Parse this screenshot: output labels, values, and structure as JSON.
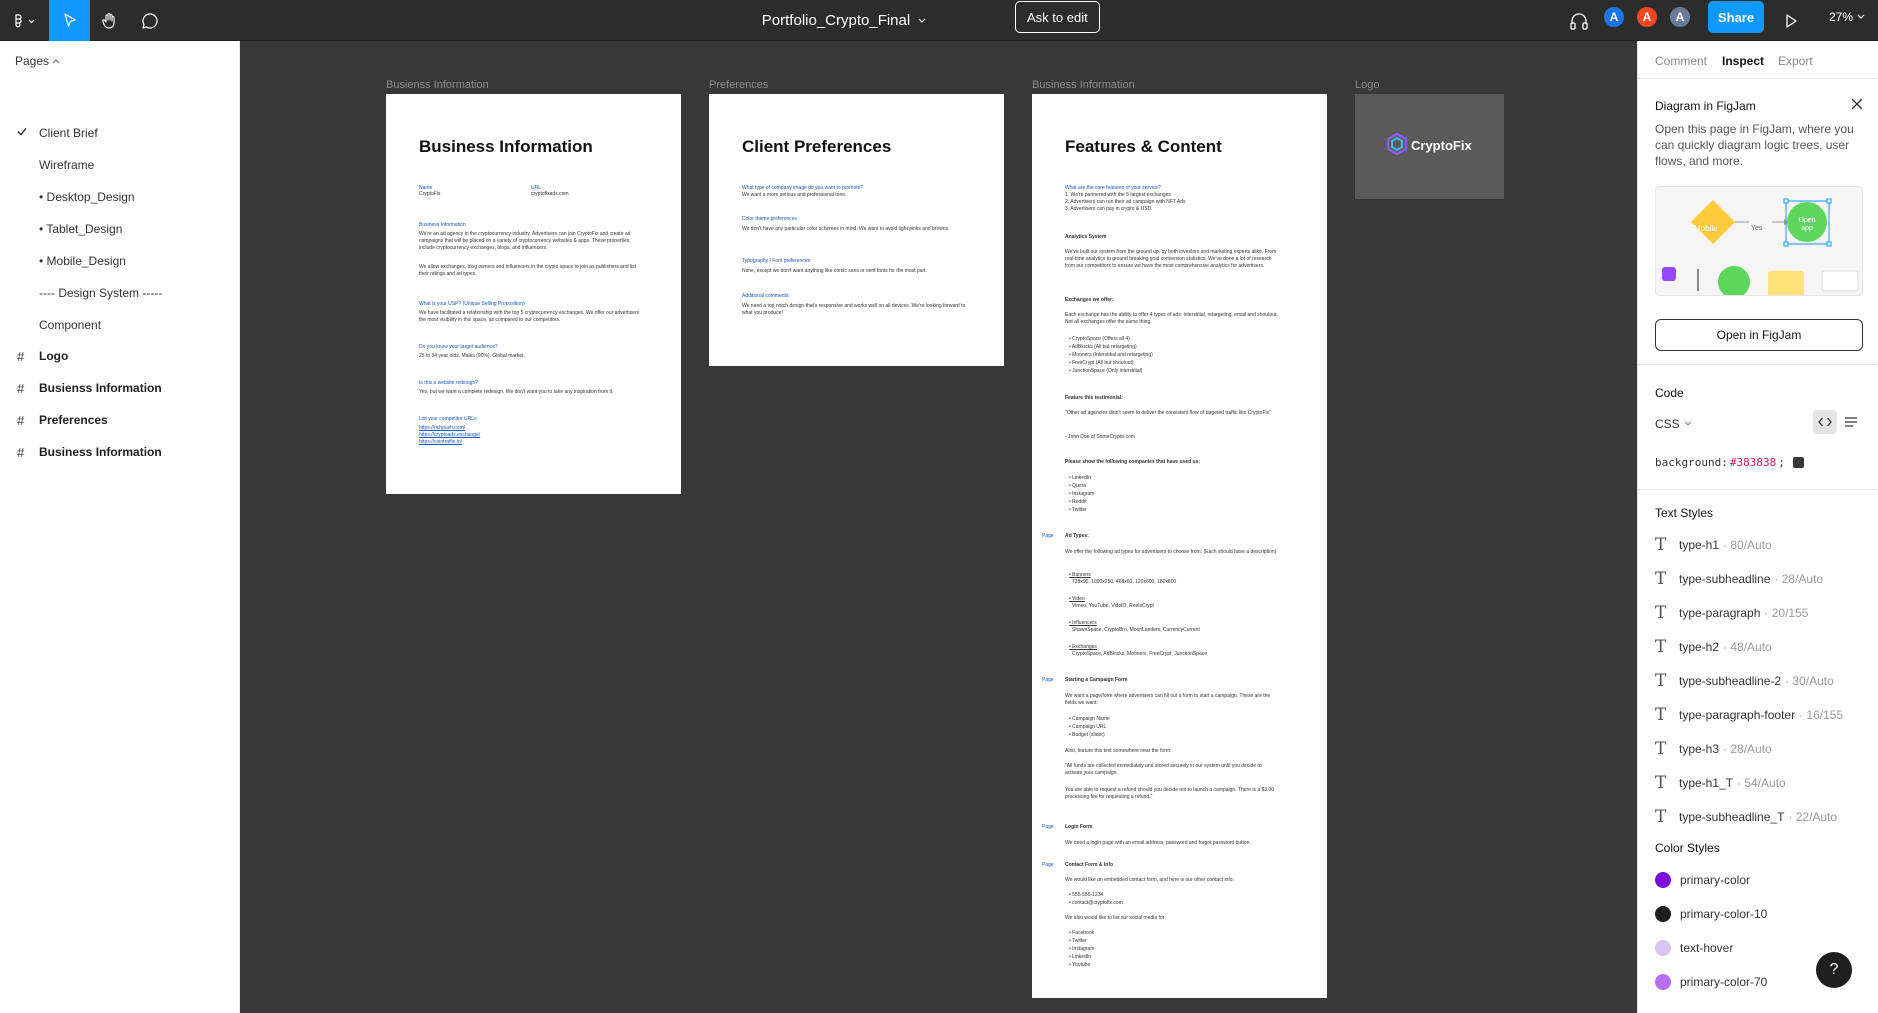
{
  "topbar": {
    "file_name": "Portfolio_Crypto_Final",
    "ask_to_edit": "Ask to edit",
    "avatars": [
      {
        "initial": "A",
        "color": "#1b74e8"
      },
      {
        "initial": "A",
        "color": "#f24822"
      },
      {
        "initial": "A",
        "color": "#6b7b99"
      }
    ],
    "share": "Share",
    "zoom": "27%"
  },
  "left": {
    "pages_label": "Pages",
    "pages": [
      {
        "label": "Client Brief",
        "selected": true
      },
      {
        "label": "Wireframe"
      },
      {
        "label": "• Desktop_Design"
      },
      {
        "label": "• Tablet_Design"
      },
      {
        "label": "• Mobile_Design"
      },
      {
        "label": "---- Design System -----"
      },
      {
        "label": "Component"
      }
    ],
    "frames": [
      {
        "label": "Logo"
      },
      {
        "label": "Busienss Information"
      },
      {
        "label": "Preferences"
      },
      {
        "label": "Business Information"
      }
    ]
  },
  "canvas": {
    "frame_labels": [
      "Busienss Information",
      "Preferences",
      "Business Information",
      "Logo"
    ],
    "biz": {
      "title": "Business Information",
      "name_q": "Name",
      "name_a": "CryptoFix",
      "url_q": "URL",
      "url_a": "cryptoflxads.com",
      "info_q": "Business Information",
      "info_a1": "We're an ad agency in the cryptocurrency industry. Advertisers can join CryptoFix and create ad campaigns that will be placed on a variety of cryptocurrency websites & apps. These properties include cryptocurrency exchanges, blogs, and influencers.",
      "info_a2": "We allow exchanges, blog owners and influencers in the crypto space to join as publishers and list their ratings and ad types.",
      "usp_q": "What is your USP? (Unique Selling Proposition)",
      "usp_a": "We have facilitated a relationship with the top 5 cryptocurrency exchanges. We offer our advertisers the most visibility in this space, as compared to our competitors.",
      "audience_q": "Do you know your target audience?",
      "audience_a": "25 to 34 year olds. Males (90%). Global market.",
      "redesign_q": "Is this a website redesign?",
      "redesign_a": "Yes, but we want a complete redesign. We don't want you to take any inspiration from it.",
      "comp_q": "List your competitor URLs:",
      "comp_urls": [
        "https://richpush.com/",
        "https://cryptoads.exchange/",
        "https://cointraffic.io/"
      ]
    },
    "pref": {
      "title": "Client Preferences",
      "q1": "What type of company image do you want to promote?",
      "a1": "We want a more serious and professional tone.",
      "q2": "Color theme preferences",
      "a2": "We don't have any particular color schemes in mind. We want to avoid light pinks and browns.",
      "q3": "Typography / Font preferences",
      "a3": "None, except we don't want anything like comic sans or serif fonts for the most part.",
      "q4": "Additional comments:",
      "a4": "We need a top notch design that's responsive and works well on all devices. We're looking forward to what you produce!"
    },
    "feat": {
      "title": "Features & Content",
      "q1": "What are the core features of your service?",
      "a1": [
        "1. We're partnered with the 5 largest exchanges",
        "2. Advertisers can run their ad campaign with NFT Ads",
        "3. Advertisers can pay in crypto & USD."
      ],
      "analytics_h": "Analytics System",
      "analytics_a": "We've built our system from the ground up, by both investors and marketing experts alike. From real-time analytics to ground breaking goal conversion statistics. We've done a lot of research from our competitors to ensure we have the most comprehensive analytics for advertisers.",
      "exch_h": "Exchanges we offer:",
      "exch_a": "Each exchange has the ability to offer 4 types of ads: interstitial, retargeting, email and shoutout. Not all exchanges offer the same thing.",
      "exch_list": [
        "• CryptoSpace (Offers all 4)",
        "• AdBlocks (All but retargeting)",
        "• Mooners (Interstitial and retargeting)",
        "• FreeCrypt (All but shoutout)",
        "• JunctionSpace (Only interstitial)"
      ],
      "testi_h": "Feature this testimonial:",
      "testi_a": "\"Other ad agencies didn't seem to deliver the consistent flow of targeted traffic like CryptoFix\"",
      "testi_by": "- John Doe of SomeCrypto.com",
      "companies_h": "Please show the following companies that have used us:",
      "companies": [
        "• LinkedIn",
        "• Quora",
        "• Instagram",
        "• Reddit",
        "• Twitter"
      ],
      "page_tag": "Page",
      "adtypes_h": "Ad Types:",
      "adtypes_a": "We offer the following ad types for advertisers to choose from: (Each should have a description)",
      "adtypes": [
        {
          "name": "• Banners",
          "desc": "728x90, 1090x250, 468x60, 120x600, 180x800"
        },
        {
          "name": "• Video",
          "desc": "Vimeo, YouTube, VidoIO, ReelsCrypt"
        },
        {
          "name": "• Influencers",
          "desc": "ShawnSpace, CryptoBro, MoonLanders, CurrencyCurrent"
        },
        {
          "name": "• Exchanges",
          "desc": "CryptoSpace, AdBlocks, Mooners, FreeCrypt, JunctionSpace"
        }
      ],
      "campaign_h": "Starting a Campaign Form",
      "campaign_a": "We want a page/form where advertisers can fill out a form to start a campaign. These are the fields we want:",
      "campaign_fields": [
        "• Campaign Name",
        "• Campaign URL",
        "• Budget (slider)"
      ],
      "campaign_also": "Also, feature this text somewhere near the form:",
      "campaign_quote": "\"All funds are collected immediately and stored securely in our system until you decide to activate your campaign.",
      "campaign_refund": "You are able to request a refund should you decide not to launch a campaign. There is a $3.00 processing fee for requesting a refund.\"",
      "login_h": "Login Form",
      "login_a": "We need a login page with an email address, password and forgot password button.",
      "contact_h": "Contact Form & Info",
      "contact_a": "We would like an embedded contact form, and here is our other contact info:",
      "contact_list": [
        "• 555-555-1234",
        "• contact@cryptofix.com"
      ],
      "social_h": "We also would like to list our social media for:",
      "social_list": [
        "• Facebook",
        "• Twitter",
        "• Instagram",
        "• LinkedIn",
        "• Youtube"
      ]
    },
    "logo_text": "CryptoFix"
  },
  "right": {
    "tabs": [
      "Comment",
      "Inspect",
      "Export"
    ],
    "active_tab": "Inspect",
    "figjam_title": "Diagram in FigJam",
    "figjam_desc": "Open this page in FigJam, where you can quickly diagram logic trees, user flows, and more.",
    "figjam_ill": {
      "mobile": "Mobile",
      "yes": "Yes",
      "open_app": "Open app"
    },
    "figjam_btn": "Open in FigJam",
    "code_label": "Code",
    "code_lang": "CSS",
    "code_prop": "background:",
    "code_value": "#383838",
    "code_end": ";",
    "text_styles_label": "Text Styles",
    "text_styles": [
      {
        "name": "type-h1",
        "meta": "· 80/Auto"
      },
      {
        "name": "type-subheadline",
        "meta": "· 28/Auto"
      },
      {
        "name": "type-paragraph",
        "meta": "· 20/155"
      },
      {
        "name": "type-h2",
        "meta": "· 48/Auto"
      },
      {
        "name": "type-subheadline-2",
        "meta": "· 30/Auto"
      },
      {
        "name": "type-paragraph-footer",
        "meta": "· 16/155"
      },
      {
        "name": "type-h3",
        "meta": "· 28/Auto"
      },
      {
        "name": "type-h1_T",
        "meta": "· 54/Auto"
      },
      {
        "name": "type-subheadline_T",
        "meta": "· 22/Auto"
      }
    ],
    "color_styles_label": "Color Styles",
    "color_styles": [
      {
        "name": "primary-color",
        "color": "#7b0cd8"
      },
      {
        "name": "primary-color-10",
        "color": "#1c1c1c"
      },
      {
        "name": "text-hover",
        "color": "#dcc4f2"
      },
      {
        "name": "primary-color-70",
        "color": "#b66df0"
      }
    ],
    "help": "?"
  }
}
